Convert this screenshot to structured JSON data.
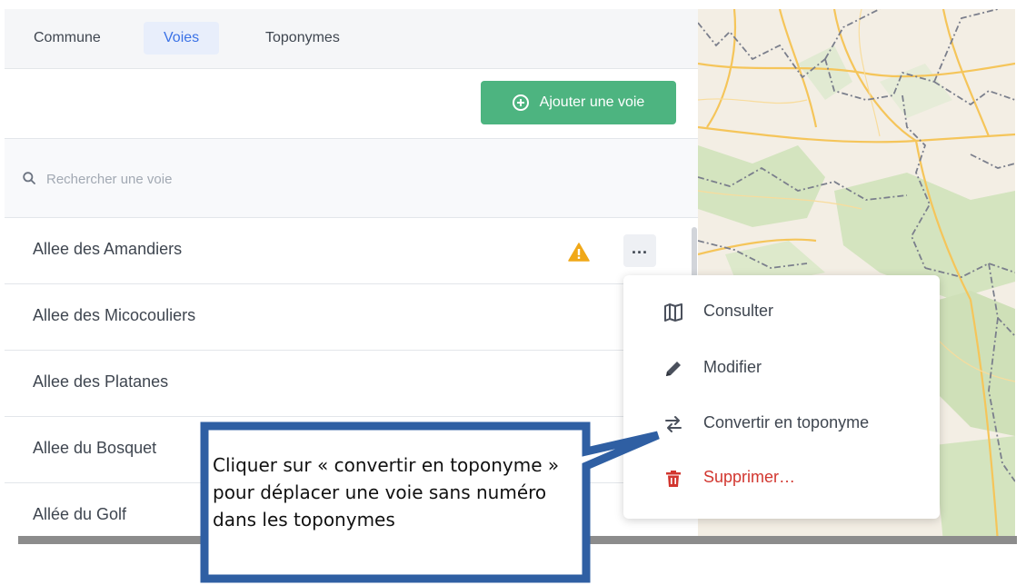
{
  "tabs": [
    {
      "label": "Commune",
      "active": false
    },
    {
      "label": "Voies",
      "active": true
    },
    {
      "label": "Toponymes",
      "active": false
    }
  ],
  "actions": {
    "add_label": "Ajouter une voie",
    "add_icon": "plus-circle-icon"
  },
  "search": {
    "placeholder": "Rechercher une voie",
    "value": ""
  },
  "voies": [
    {
      "label": "Allee des Amandiers",
      "warning": true,
      "menu_open": true
    },
    {
      "label": "Allee des Micocouliers"
    },
    {
      "label": "Allee des Platanes"
    },
    {
      "label": "Allee du Bosquet"
    },
    {
      "label": "Allée du Golf"
    }
  ],
  "menu": {
    "items": [
      {
        "label": "Consulter",
        "icon": "map-icon"
      },
      {
        "label": "Modifier",
        "icon": "pencil-icon"
      },
      {
        "label": "Convertir en toponyme",
        "icon": "exchange-icon"
      },
      {
        "label": "Supprimer…",
        "icon": "trash-icon",
        "danger": true
      }
    ]
  },
  "callout": {
    "text": "Cliquer sur « convertir en toponyme » pour déplacer une voie sans numéro dans les toponymes"
  },
  "colors": {
    "accent": "#3b72e6",
    "add_button": "#4db480",
    "warning": "#f0a818",
    "danger": "#d2362f",
    "callout_border": "#2f5fa3"
  }
}
